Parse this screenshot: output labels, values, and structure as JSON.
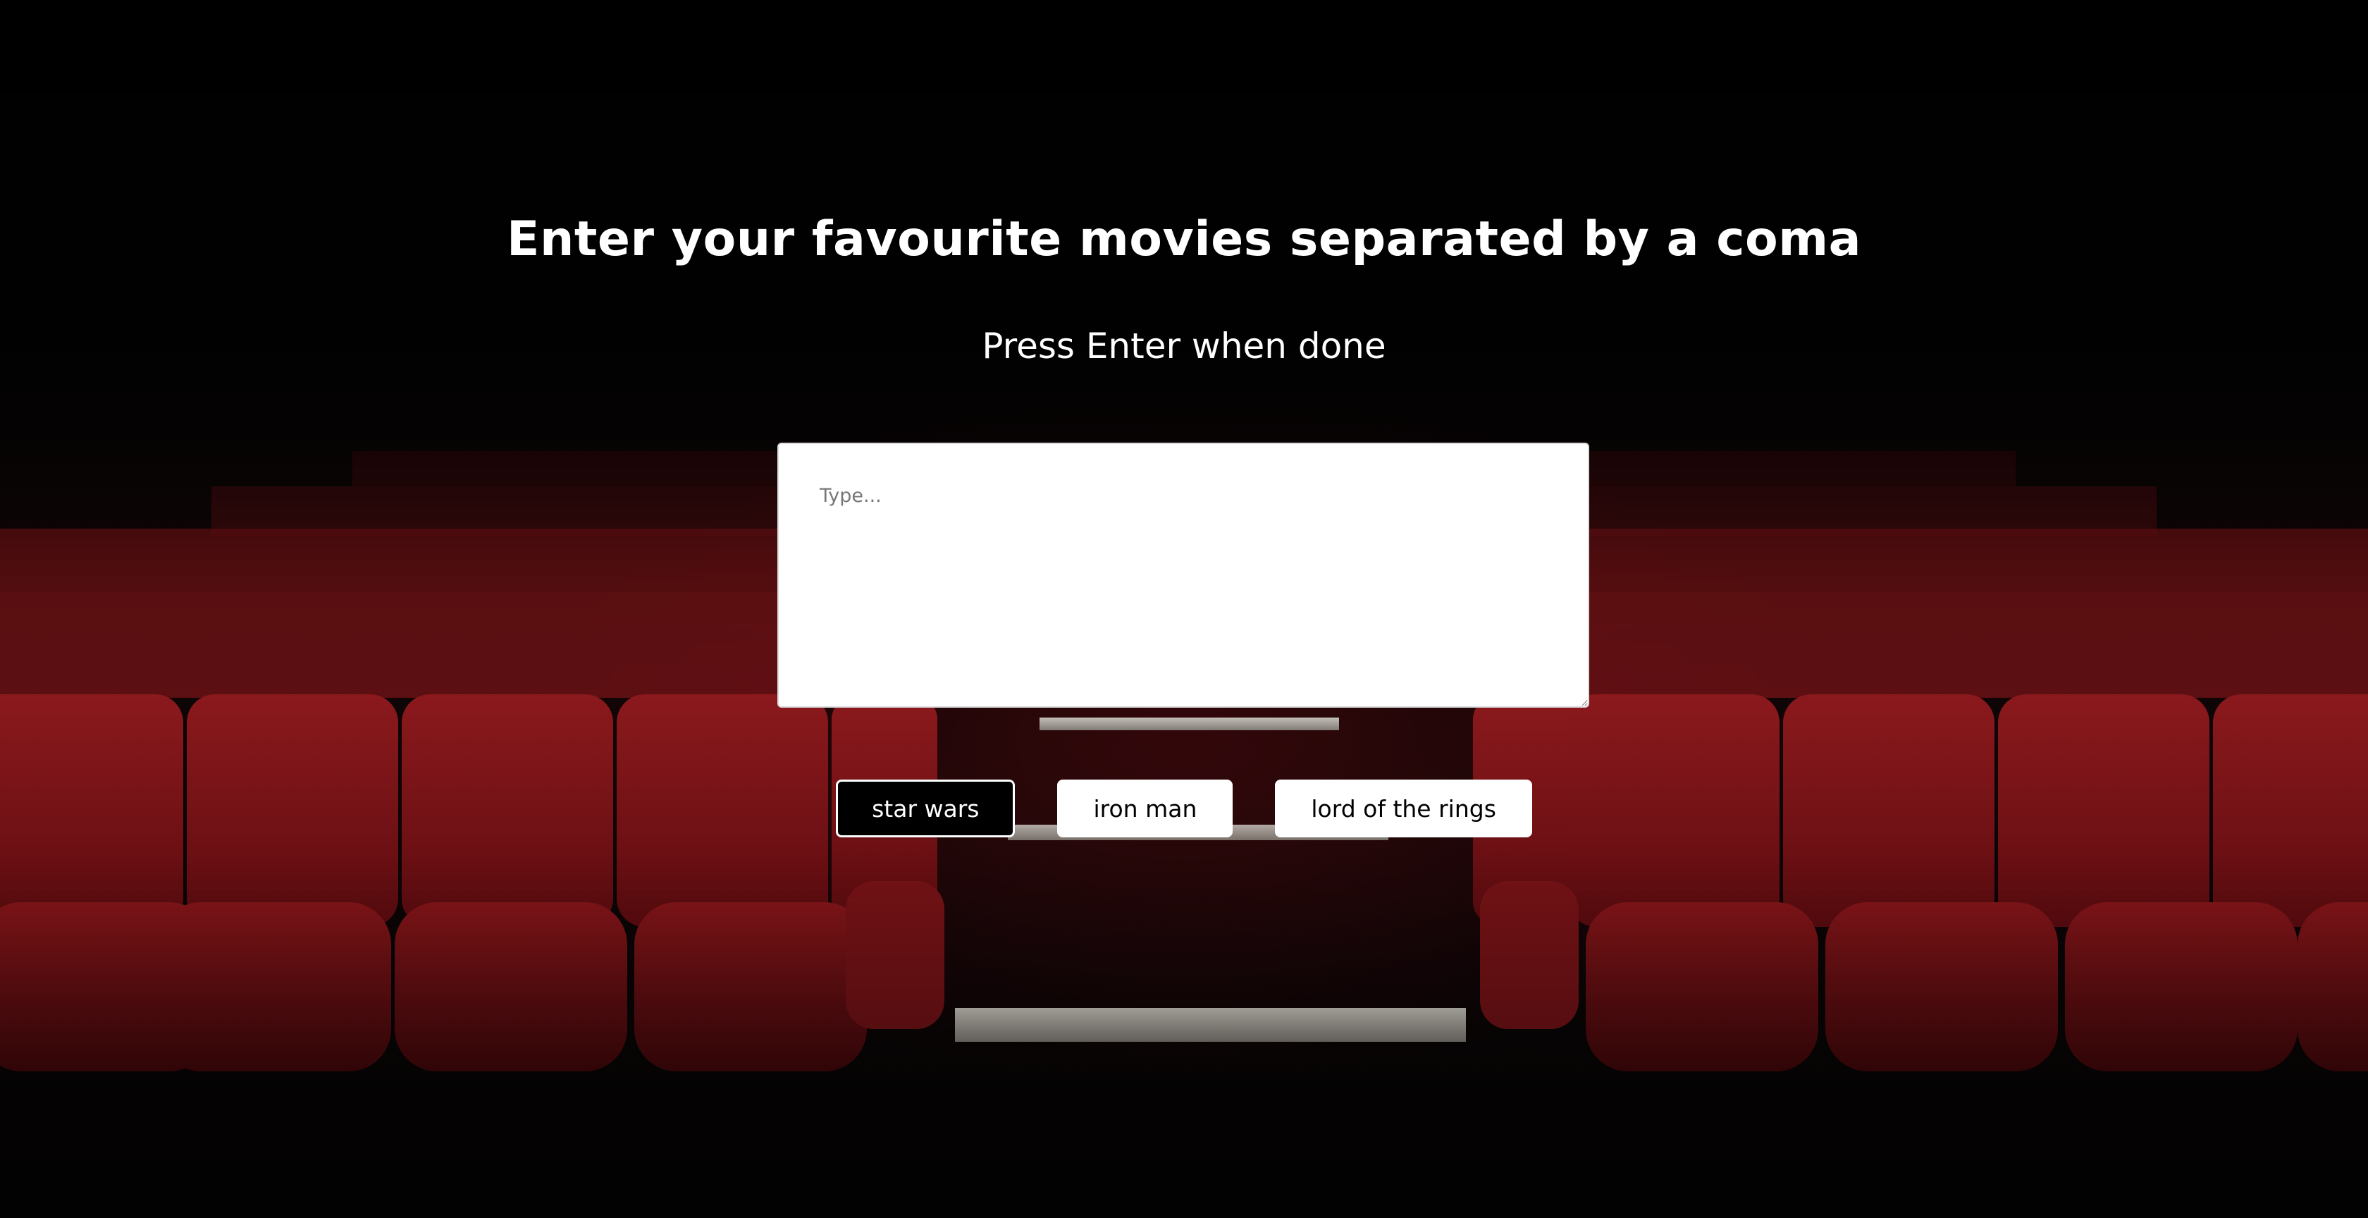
{
  "page": {
    "title": "Enter your favourite movies separated by a coma",
    "subtitle": "Press Enter when done"
  },
  "input": {
    "placeholder": "Type...",
    "value": ""
  },
  "suggestions": [
    {
      "label": "star wars",
      "selected": true
    },
    {
      "label": "iron man",
      "selected": false
    },
    {
      "label": "lord of the rings",
      "selected": false
    }
  ],
  "colors": {
    "seat": "#8a1418",
    "background": "#050303",
    "text": "#ffffff",
    "chip_selected_bg": "#000000",
    "chip_unselected_bg": "#ffffff"
  }
}
